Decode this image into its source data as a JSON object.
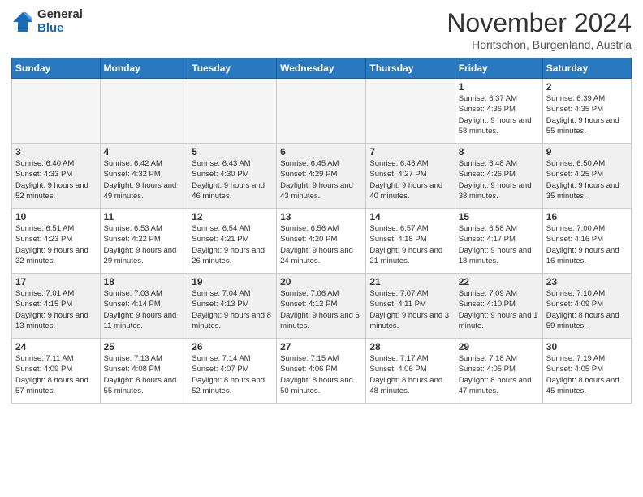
{
  "logo": {
    "general": "General",
    "blue": "Blue"
  },
  "header": {
    "month": "November 2024",
    "location": "Horitschon, Burgenland, Austria"
  },
  "days_of_week": [
    "Sunday",
    "Monday",
    "Tuesday",
    "Wednesday",
    "Thursday",
    "Friday",
    "Saturday"
  ],
  "weeks": [
    {
      "days": [
        {
          "num": "",
          "info": ""
        },
        {
          "num": "",
          "info": ""
        },
        {
          "num": "",
          "info": ""
        },
        {
          "num": "",
          "info": ""
        },
        {
          "num": "",
          "info": ""
        },
        {
          "num": "1",
          "info": "Sunrise: 6:37 AM\nSunset: 4:36 PM\nDaylight: 9 hours and 58 minutes."
        },
        {
          "num": "2",
          "info": "Sunrise: 6:39 AM\nSunset: 4:35 PM\nDaylight: 9 hours and 55 minutes."
        }
      ]
    },
    {
      "days": [
        {
          "num": "3",
          "info": "Sunrise: 6:40 AM\nSunset: 4:33 PM\nDaylight: 9 hours and 52 minutes."
        },
        {
          "num": "4",
          "info": "Sunrise: 6:42 AM\nSunset: 4:32 PM\nDaylight: 9 hours and 49 minutes."
        },
        {
          "num": "5",
          "info": "Sunrise: 6:43 AM\nSunset: 4:30 PM\nDaylight: 9 hours and 46 minutes."
        },
        {
          "num": "6",
          "info": "Sunrise: 6:45 AM\nSunset: 4:29 PM\nDaylight: 9 hours and 43 minutes."
        },
        {
          "num": "7",
          "info": "Sunrise: 6:46 AM\nSunset: 4:27 PM\nDaylight: 9 hours and 40 minutes."
        },
        {
          "num": "8",
          "info": "Sunrise: 6:48 AM\nSunset: 4:26 PM\nDaylight: 9 hours and 38 minutes."
        },
        {
          "num": "9",
          "info": "Sunrise: 6:50 AM\nSunset: 4:25 PM\nDaylight: 9 hours and 35 minutes."
        }
      ]
    },
    {
      "days": [
        {
          "num": "10",
          "info": "Sunrise: 6:51 AM\nSunset: 4:23 PM\nDaylight: 9 hours and 32 minutes."
        },
        {
          "num": "11",
          "info": "Sunrise: 6:53 AM\nSunset: 4:22 PM\nDaylight: 9 hours and 29 minutes."
        },
        {
          "num": "12",
          "info": "Sunrise: 6:54 AM\nSunset: 4:21 PM\nDaylight: 9 hours and 26 minutes."
        },
        {
          "num": "13",
          "info": "Sunrise: 6:56 AM\nSunset: 4:20 PM\nDaylight: 9 hours and 24 minutes."
        },
        {
          "num": "14",
          "info": "Sunrise: 6:57 AM\nSunset: 4:18 PM\nDaylight: 9 hours and 21 minutes."
        },
        {
          "num": "15",
          "info": "Sunrise: 6:58 AM\nSunset: 4:17 PM\nDaylight: 9 hours and 18 minutes."
        },
        {
          "num": "16",
          "info": "Sunrise: 7:00 AM\nSunset: 4:16 PM\nDaylight: 9 hours and 16 minutes."
        }
      ]
    },
    {
      "days": [
        {
          "num": "17",
          "info": "Sunrise: 7:01 AM\nSunset: 4:15 PM\nDaylight: 9 hours and 13 minutes."
        },
        {
          "num": "18",
          "info": "Sunrise: 7:03 AM\nSunset: 4:14 PM\nDaylight: 9 hours and 11 minutes."
        },
        {
          "num": "19",
          "info": "Sunrise: 7:04 AM\nSunset: 4:13 PM\nDaylight: 9 hours and 8 minutes."
        },
        {
          "num": "20",
          "info": "Sunrise: 7:06 AM\nSunset: 4:12 PM\nDaylight: 9 hours and 6 minutes."
        },
        {
          "num": "21",
          "info": "Sunrise: 7:07 AM\nSunset: 4:11 PM\nDaylight: 9 hours and 3 minutes."
        },
        {
          "num": "22",
          "info": "Sunrise: 7:09 AM\nSunset: 4:10 PM\nDaylight: 9 hours and 1 minute."
        },
        {
          "num": "23",
          "info": "Sunrise: 7:10 AM\nSunset: 4:09 PM\nDaylight: 8 hours and 59 minutes."
        }
      ]
    },
    {
      "days": [
        {
          "num": "24",
          "info": "Sunrise: 7:11 AM\nSunset: 4:09 PM\nDaylight: 8 hours and 57 minutes."
        },
        {
          "num": "25",
          "info": "Sunrise: 7:13 AM\nSunset: 4:08 PM\nDaylight: 8 hours and 55 minutes."
        },
        {
          "num": "26",
          "info": "Sunrise: 7:14 AM\nSunset: 4:07 PM\nDaylight: 8 hours and 52 minutes."
        },
        {
          "num": "27",
          "info": "Sunrise: 7:15 AM\nSunset: 4:06 PM\nDaylight: 8 hours and 50 minutes."
        },
        {
          "num": "28",
          "info": "Sunrise: 7:17 AM\nSunset: 4:06 PM\nDaylight: 8 hours and 48 minutes."
        },
        {
          "num": "29",
          "info": "Sunrise: 7:18 AM\nSunset: 4:05 PM\nDaylight: 8 hours and 47 minutes."
        },
        {
          "num": "30",
          "info": "Sunrise: 7:19 AM\nSunset: 4:05 PM\nDaylight: 8 hours and 45 minutes."
        }
      ]
    }
  ]
}
